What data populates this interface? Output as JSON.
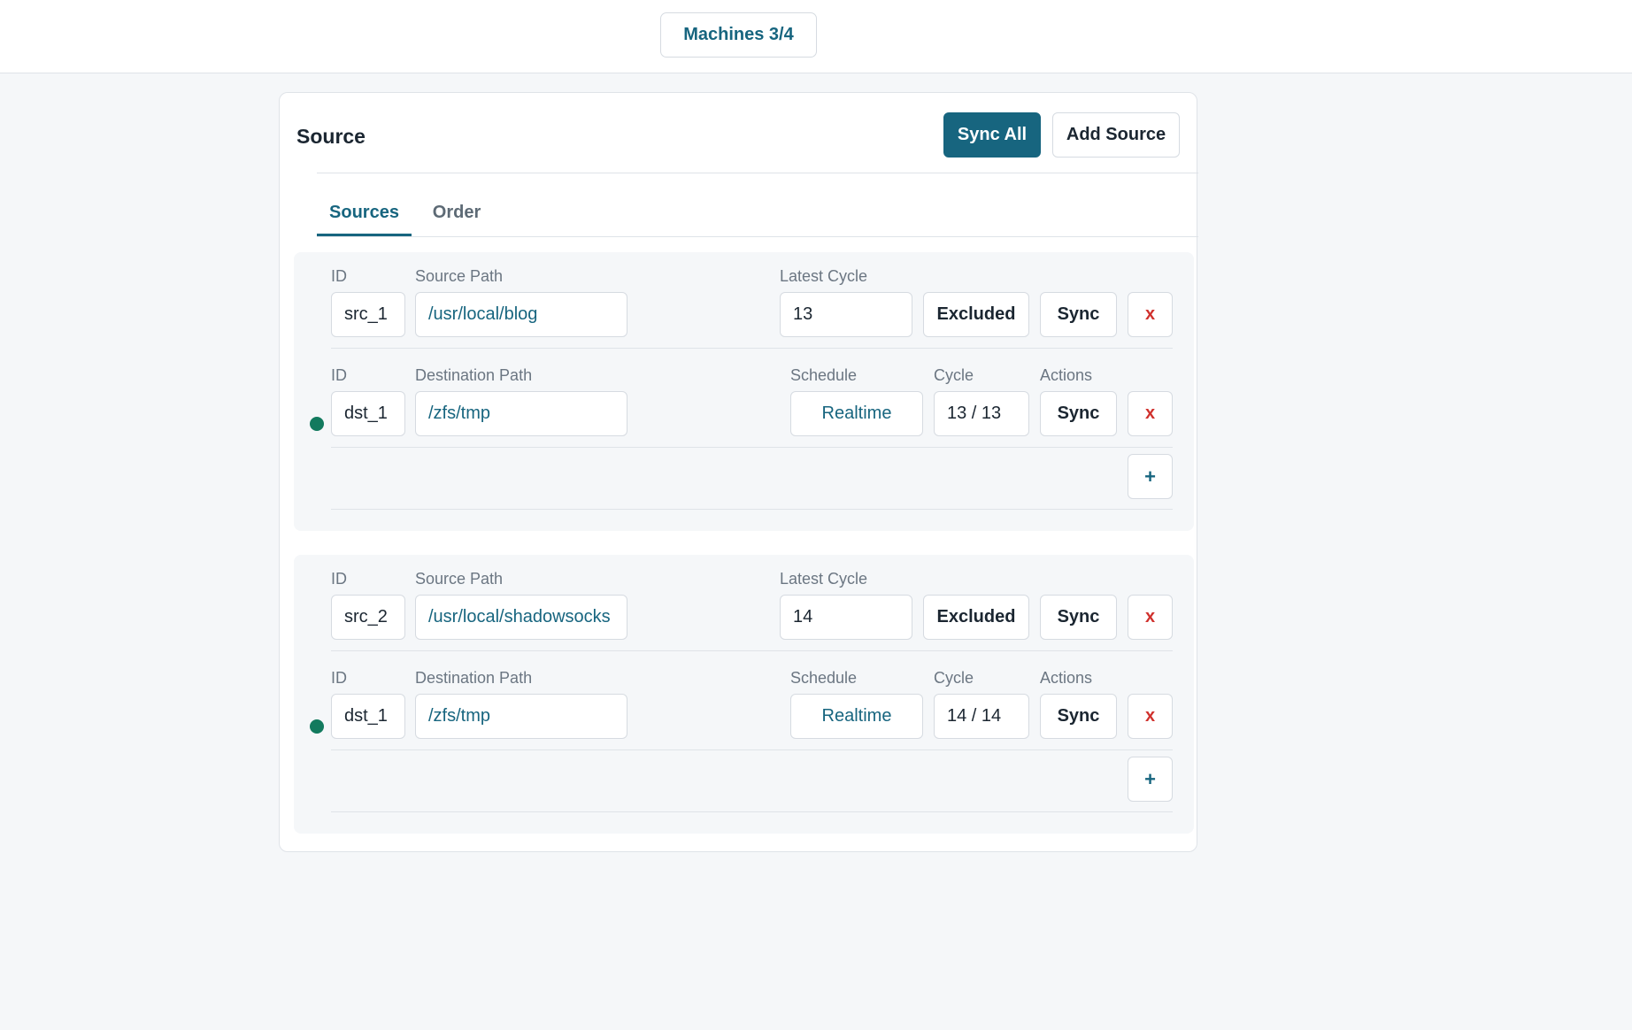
{
  "topbar": {
    "machines_label": "Machines 3/4"
  },
  "card": {
    "title": "Source",
    "sync_all_label": "Sync All",
    "add_source_label": "Add Source",
    "tabs": [
      {
        "label": "Sources",
        "active": true
      },
      {
        "label": "Order",
        "active": false
      }
    ]
  },
  "sources": [
    {
      "labels": {
        "id": "ID",
        "path": "Source Path",
        "latest_cycle": "Latest Cycle"
      },
      "id": "src_1",
      "path": "/usr/local/blog",
      "latest_cycle": "13",
      "excluded_label": "Excluded",
      "sync_label": "Sync",
      "remove_label": "x",
      "destination": {
        "labels": {
          "id": "ID",
          "path": "Destination Path",
          "schedule": "Schedule",
          "cycle": "Cycle",
          "actions": "Actions"
        },
        "status_color": "#127a5e",
        "id": "dst_1",
        "path": "/zfs/tmp",
        "schedule": "Realtime",
        "cycle": "13 / 13",
        "sync_label": "Sync",
        "remove_label": "x"
      },
      "add_label": "+"
    },
    {
      "labels": {
        "id": "ID",
        "path": "Source Path",
        "latest_cycle": "Latest Cycle"
      },
      "id": "src_2",
      "path": "/usr/local/shadowsocks",
      "latest_cycle": "14",
      "excluded_label": "Excluded",
      "sync_label": "Sync",
      "remove_label": "x",
      "destination": {
        "labels": {
          "id": "ID",
          "path": "Destination Path",
          "schedule": "Schedule",
          "cycle": "Cycle",
          "actions": "Actions"
        },
        "status_color": "#127a5e",
        "id": "dst_1",
        "path": "/zfs/tmp",
        "schedule": "Realtime",
        "cycle": "14 / 14",
        "sync_label": "Sync",
        "remove_label": "x"
      },
      "add_label": "+"
    }
  ],
  "colors": {
    "accent": "#17657f",
    "danger": "#d0312d",
    "status_ok": "#127a5e"
  }
}
